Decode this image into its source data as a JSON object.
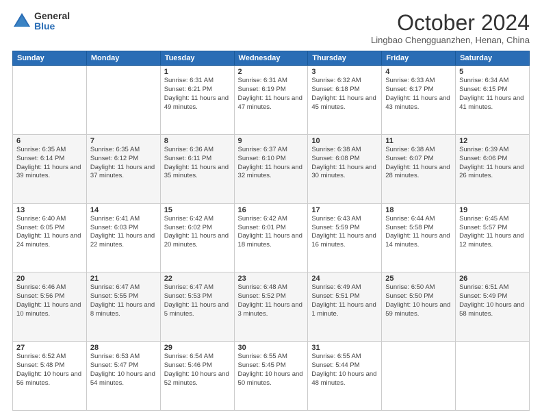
{
  "logo": {
    "general": "General",
    "blue": "Blue"
  },
  "header": {
    "month": "October 2024",
    "location": "Lingbao Chengguanzhen, Henan, China"
  },
  "weekdays": [
    "Sunday",
    "Monday",
    "Tuesday",
    "Wednesday",
    "Thursday",
    "Friday",
    "Saturday"
  ],
  "days": [
    {
      "date": "",
      "sunrise": "",
      "sunset": "",
      "daylight": ""
    },
    {
      "date": "",
      "sunrise": "",
      "sunset": "",
      "daylight": ""
    },
    {
      "date": "1",
      "sunrise": "Sunrise: 6:31 AM",
      "sunset": "Sunset: 6:21 PM",
      "daylight": "Daylight: 11 hours and 49 minutes."
    },
    {
      "date": "2",
      "sunrise": "Sunrise: 6:31 AM",
      "sunset": "Sunset: 6:19 PM",
      "daylight": "Daylight: 11 hours and 47 minutes."
    },
    {
      "date": "3",
      "sunrise": "Sunrise: 6:32 AM",
      "sunset": "Sunset: 6:18 PM",
      "daylight": "Daylight: 11 hours and 45 minutes."
    },
    {
      "date": "4",
      "sunrise": "Sunrise: 6:33 AM",
      "sunset": "Sunset: 6:17 PM",
      "daylight": "Daylight: 11 hours and 43 minutes."
    },
    {
      "date": "5",
      "sunrise": "Sunrise: 6:34 AM",
      "sunset": "Sunset: 6:15 PM",
      "daylight": "Daylight: 11 hours and 41 minutes."
    },
    {
      "date": "6",
      "sunrise": "Sunrise: 6:35 AM",
      "sunset": "Sunset: 6:14 PM",
      "daylight": "Daylight: 11 hours and 39 minutes."
    },
    {
      "date": "7",
      "sunrise": "Sunrise: 6:35 AM",
      "sunset": "Sunset: 6:12 PM",
      "daylight": "Daylight: 11 hours and 37 minutes."
    },
    {
      "date": "8",
      "sunrise": "Sunrise: 6:36 AM",
      "sunset": "Sunset: 6:11 PM",
      "daylight": "Daylight: 11 hours and 35 minutes."
    },
    {
      "date": "9",
      "sunrise": "Sunrise: 6:37 AM",
      "sunset": "Sunset: 6:10 PM",
      "daylight": "Daylight: 11 hours and 32 minutes."
    },
    {
      "date": "10",
      "sunrise": "Sunrise: 6:38 AM",
      "sunset": "Sunset: 6:08 PM",
      "daylight": "Daylight: 11 hours and 30 minutes."
    },
    {
      "date": "11",
      "sunrise": "Sunrise: 6:38 AM",
      "sunset": "Sunset: 6:07 PM",
      "daylight": "Daylight: 11 hours and 28 minutes."
    },
    {
      "date": "12",
      "sunrise": "Sunrise: 6:39 AM",
      "sunset": "Sunset: 6:06 PM",
      "daylight": "Daylight: 11 hours and 26 minutes."
    },
    {
      "date": "13",
      "sunrise": "Sunrise: 6:40 AM",
      "sunset": "Sunset: 6:05 PM",
      "daylight": "Daylight: 11 hours and 24 minutes."
    },
    {
      "date": "14",
      "sunrise": "Sunrise: 6:41 AM",
      "sunset": "Sunset: 6:03 PM",
      "daylight": "Daylight: 11 hours and 22 minutes."
    },
    {
      "date": "15",
      "sunrise": "Sunrise: 6:42 AM",
      "sunset": "Sunset: 6:02 PM",
      "daylight": "Daylight: 11 hours and 20 minutes."
    },
    {
      "date": "16",
      "sunrise": "Sunrise: 6:42 AM",
      "sunset": "Sunset: 6:01 PM",
      "daylight": "Daylight: 11 hours and 18 minutes."
    },
    {
      "date": "17",
      "sunrise": "Sunrise: 6:43 AM",
      "sunset": "Sunset: 5:59 PM",
      "daylight": "Daylight: 11 hours and 16 minutes."
    },
    {
      "date": "18",
      "sunrise": "Sunrise: 6:44 AM",
      "sunset": "Sunset: 5:58 PM",
      "daylight": "Daylight: 11 hours and 14 minutes."
    },
    {
      "date": "19",
      "sunrise": "Sunrise: 6:45 AM",
      "sunset": "Sunset: 5:57 PM",
      "daylight": "Daylight: 11 hours and 12 minutes."
    },
    {
      "date": "20",
      "sunrise": "Sunrise: 6:46 AM",
      "sunset": "Sunset: 5:56 PM",
      "daylight": "Daylight: 11 hours and 10 minutes."
    },
    {
      "date": "21",
      "sunrise": "Sunrise: 6:47 AM",
      "sunset": "Sunset: 5:55 PM",
      "daylight": "Daylight: 11 hours and 8 minutes."
    },
    {
      "date": "22",
      "sunrise": "Sunrise: 6:47 AM",
      "sunset": "Sunset: 5:53 PM",
      "daylight": "Daylight: 11 hours and 5 minutes."
    },
    {
      "date": "23",
      "sunrise": "Sunrise: 6:48 AM",
      "sunset": "Sunset: 5:52 PM",
      "daylight": "Daylight: 11 hours and 3 minutes."
    },
    {
      "date": "24",
      "sunrise": "Sunrise: 6:49 AM",
      "sunset": "Sunset: 5:51 PM",
      "daylight": "Daylight: 11 hours and 1 minute."
    },
    {
      "date": "25",
      "sunrise": "Sunrise: 6:50 AM",
      "sunset": "Sunset: 5:50 PM",
      "daylight": "Daylight: 10 hours and 59 minutes."
    },
    {
      "date": "26",
      "sunrise": "Sunrise: 6:51 AM",
      "sunset": "Sunset: 5:49 PM",
      "daylight": "Daylight: 10 hours and 58 minutes."
    },
    {
      "date": "27",
      "sunrise": "Sunrise: 6:52 AM",
      "sunset": "Sunset: 5:48 PM",
      "daylight": "Daylight: 10 hours and 56 minutes."
    },
    {
      "date": "28",
      "sunrise": "Sunrise: 6:53 AM",
      "sunset": "Sunset: 5:47 PM",
      "daylight": "Daylight: 10 hours and 54 minutes."
    },
    {
      "date": "29",
      "sunrise": "Sunrise: 6:54 AM",
      "sunset": "Sunset: 5:46 PM",
      "daylight": "Daylight: 10 hours and 52 minutes."
    },
    {
      "date": "30",
      "sunrise": "Sunrise: 6:55 AM",
      "sunset": "Sunset: 5:45 PM",
      "daylight": "Daylight: 10 hours and 50 minutes."
    },
    {
      "date": "31",
      "sunrise": "Sunrise: 6:55 AM",
      "sunset": "Sunset: 5:44 PM",
      "daylight": "Daylight: 10 hours and 48 minutes."
    },
    {
      "date": "",
      "sunrise": "",
      "sunset": "",
      "daylight": ""
    },
    {
      "date": "",
      "sunrise": "",
      "sunset": "",
      "daylight": ""
    }
  ]
}
